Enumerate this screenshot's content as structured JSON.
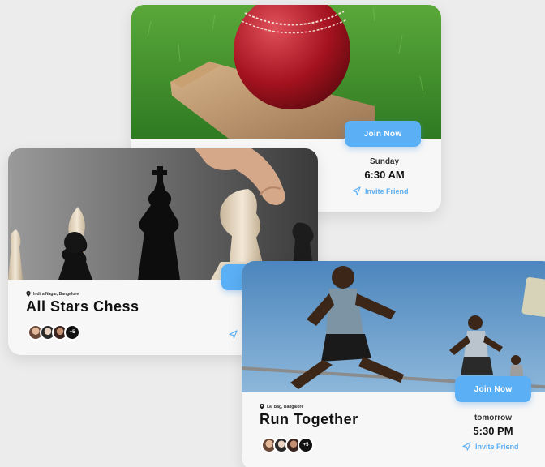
{
  "cricket_card": {
    "join_label": "Join Now",
    "day": "Sunday",
    "time": "6:30 AM",
    "invite_label": "Invite Friend"
  },
  "chess_card": {
    "location": "Indira Nagar, Bangalore",
    "title": "All Stars Chess",
    "more_count": "+5"
  },
  "run_card": {
    "location": "Lal Bag, Bangalore",
    "title": "Run Together",
    "join_label": "Join Now",
    "day": "tomorrow",
    "time": "5:30 PM",
    "invite_label": "Invite Friend",
    "more_count": "+5"
  },
  "colors": {
    "accent": "#5aaff5",
    "background": "#ececec",
    "card": "#f7f7f7"
  },
  "icons": [
    "location-pin-icon",
    "send-icon"
  ]
}
